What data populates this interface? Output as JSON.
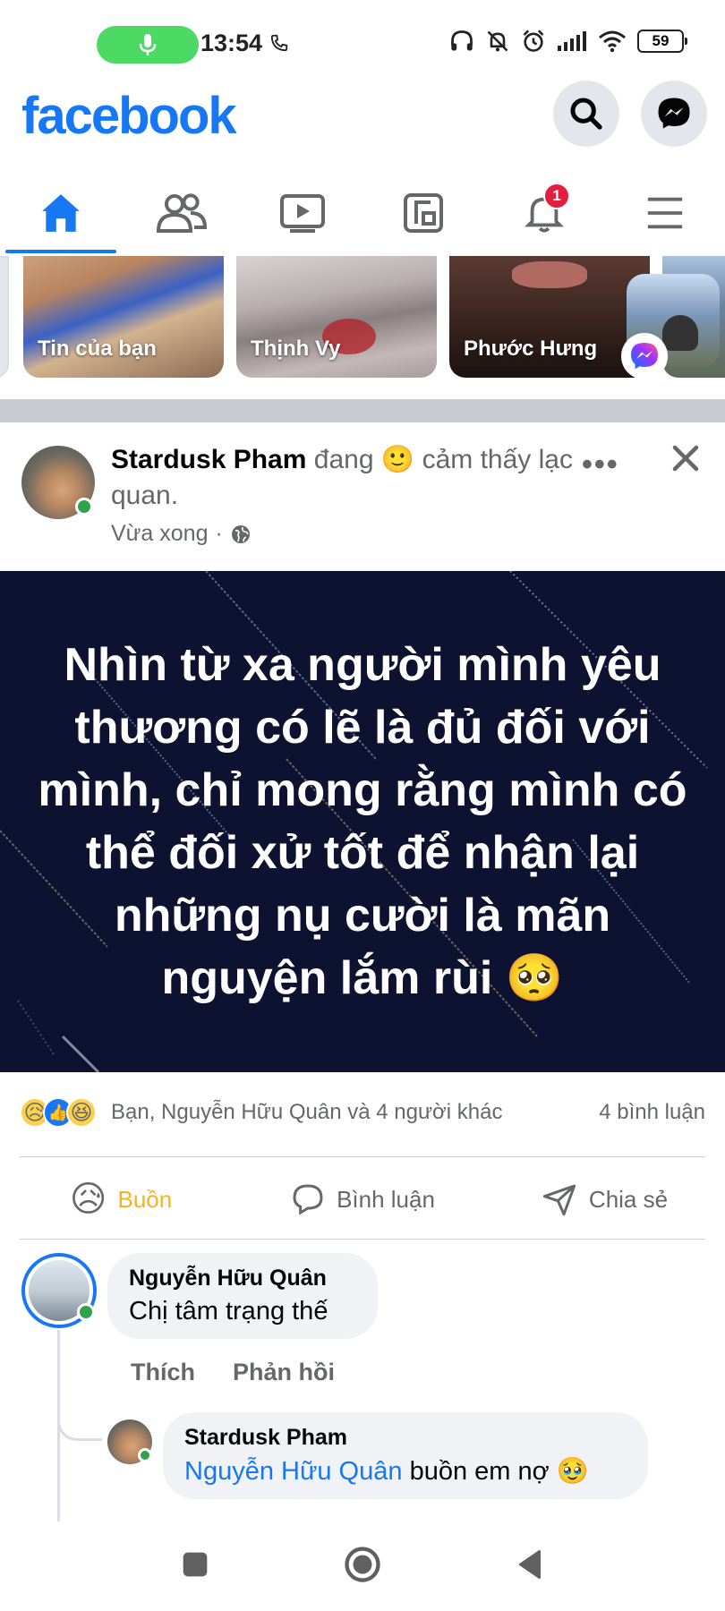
{
  "status_bar": {
    "time": "13:54",
    "battery": "59",
    "icons": [
      "headphones-icon",
      "mute-bell-icon",
      "alarm-icon",
      "signal-icon",
      "wifi-icon"
    ]
  },
  "header": {
    "logo": "facebook",
    "search_icon": "search-icon",
    "messenger_icon": "messenger-icon",
    "accent_color": "#1877f2"
  },
  "nav": {
    "tabs": [
      "home",
      "friends",
      "watch",
      "pages",
      "notifications",
      "menu"
    ],
    "notification_badge": "1"
  },
  "stories": [
    {
      "label": "Tin của bạn"
    },
    {
      "label": "Thịnh Vy"
    },
    {
      "label": "Phước Hưng"
    }
  ],
  "post": {
    "author": "Stardusk Pham",
    "feeling_prefix": "đang",
    "feeling_emoji": "🙂",
    "feeling_text": "cảm thấy lạc quan.",
    "time": "Vừa xong",
    "separator": "·",
    "body": "Nhìn từ xa người mình yêu thương có lẽ là đủ đối với mình, chỉ mong rằng mình có thể đối xử tốt để nhận lại những nụ cười là mãn nguyện lắm rùi 🥺",
    "reactions_text": "Bạn, Nguyễn Hữu Quân và 4 người khác",
    "comments_count": "4 bình luận",
    "reaction_emojis": [
      "😥",
      "👍",
      "😆"
    ]
  },
  "actions": {
    "sad_emoji": "😥",
    "sad_label": "Buồn",
    "comment_label": "Bình luận",
    "share_label": "Chia sẻ"
  },
  "comments": [
    {
      "name": "Nguyễn Hữu Quân",
      "text": "Chị tâm trạng thế",
      "like_label": "Thích",
      "reply_label": "Phản hồi"
    },
    {
      "name": "Stardusk Pham",
      "mention": "Nguyễn Hữu Quân",
      "text": "buồn em nợ 🥹"
    }
  ]
}
